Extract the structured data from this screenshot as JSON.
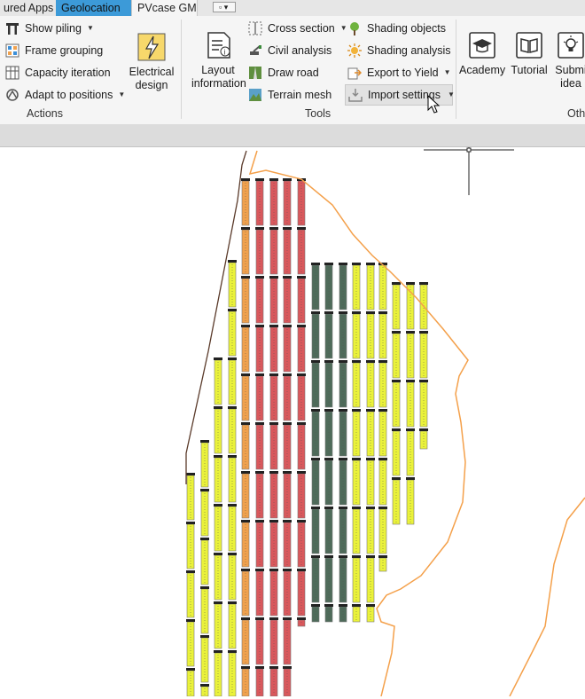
{
  "tabs": [
    {
      "label": "ured Apps"
    },
    {
      "label": "Geolocation"
    },
    {
      "label": "PVcase GM"
    },
    {
      "label": "▫ ▾"
    }
  ],
  "actions": {
    "show_piling": "Show piling",
    "frame_grouping": "Frame grouping",
    "capacity_iteration": "Capacity iteration",
    "adapt_to_positions": "Adapt to positions",
    "electrical_design_line1": "Electrical",
    "electrical_design_line2": "design",
    "group_label": "Actions"
  },
  "tools": {
    "layout_information_line1": "Layout",
    "layout_information_line2": "information",
    "cross_section": "Cross section",
    "civil_analysis": "Civil analysis",
    "draw_road": "Draw road",
    "terrain_mesh": "Terrain mesh",
    "shading_objects": "Shading objects",
    "shading_analysis": "Shading analysis",
    "export_to_yield": "Export to Yield",
    "import_settings": "Import settings",
    "group_label": "Tools"
  },
  "other": {
    "academy": "Academy",
    "tutorial": "Tutorial",
    "submit_idea_line1": "Submi",
    "submit_idea_line2": "idea",
    "group_label": "Oth"
  },
  "colors": {
    "tab_active": "#3c9ad8",
    "boundary": "#f4a04a",
    "row_yellow": "#eaf23a",
    "row_orange": "#f0a14d",
    "row_red": "#d9585c",
    "row_darkgreen": "#4e6b5a"
  }
}
